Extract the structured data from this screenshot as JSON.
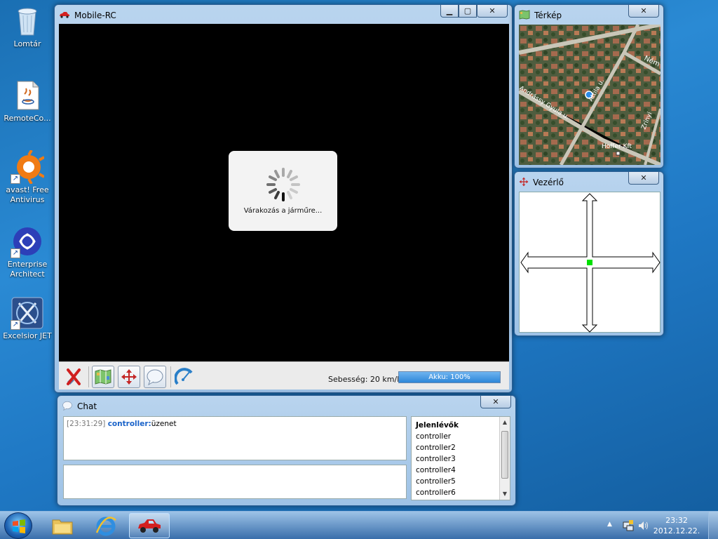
{
  "desktop": {
    "icons": [
      {
        "label": "Lomtár",
        "icon": "recycle-bin-icon"
      },
      {
        "label": "RemoteCo...",
        "icon": "java-file-icon"
      },
      {
        "label": "avast! Free Antivirus",
        "icon": "avast-icon"
      },
      {
        "label": "Enterprise Architect",
        "icon": "enterprise-architect-icon"
      },
      {
        "label": "Excelsior JET",
        "icon": "excelsior-jet-icon"
      }
    ]
  },
  "main_window": {
    "title": "Mobile-RC",
    "loading_message": "Várakozás a járműre...",
    "speed_label": "Sebesség: 20 km/h",
    "battery_label": "Akku: 100%",
    "battery_level": 1.0,
    "toolbar": {
      "disconnect": "disconnect-icon",
      "map_toggle": "map-icon",
      "control_toggle": "move-arrows-icon",
      "chat_toggle": "chat-bubble-icon",
      "speed_gauge": "speedometer-icon"
    }
  },
  "map_window": {
    "title": "Térkép",
    "labels": {
      "street1": "Andrássy Gyula u.",
      "street2": "Attila u.",
      "street3": "Zrínyi",
      "street4": "Ném",
      "poi": "Hoffer Kft"
    }
  },
  "control_window": {
    "title": "Vezérlő"
  },
  "chat_window": {
    "title": "Chat",
    "messages": [
      {
        "time": "[23:31:29]",
        "user": "controller:",
        "text": "üzenet"
      }
    ],
    "users_header": "Jelenlévők",
    "users": [
      "controller",
      "controller2",
      "controller3",
      "controller4",
      "controller5",
      "controller6"
    ]
  },
  "taskbar": {
    "time": "23:32",
    "date": "2012.12.22."
  },
  "colors": {
    "accent": "#1e7ad6",
    "chat_user": "#1a63c9",
    "center_dot": "#00e000"
  }
}
